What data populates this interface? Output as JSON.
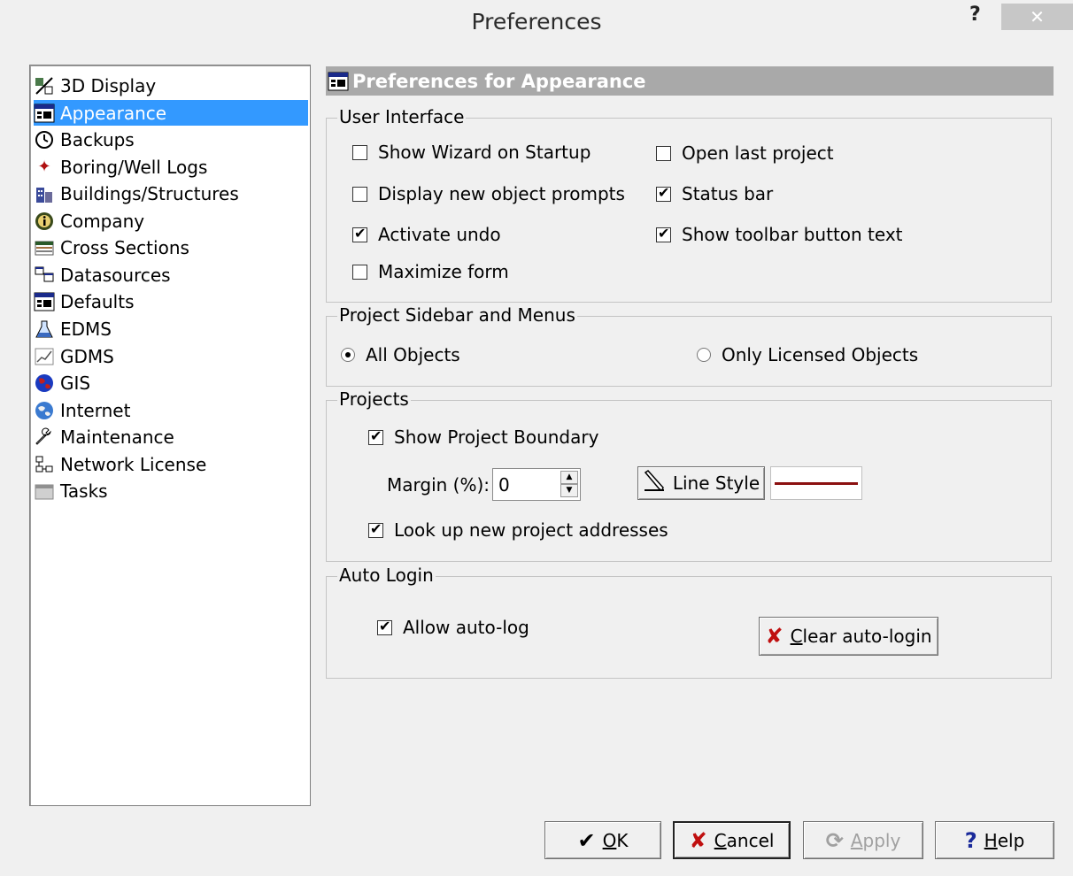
{
  "window": {
    "title": "Preferences",
    "help": "?",
    "close": "✕"
  },
  "tree": {
    "items": [
      {
        "label": "3D Display",
        "icon": "3d-display-icon",
        "selected": false
      },
      {
        "label": "Appearance",
        "icon": "appearance-icon",
        "selected": true
      },
      {
        "label": "Backups",
        "icon": "clock-icon",
        "selected": false
      },
      {
        "label": "Boring/Well Logs",
        "icon": "boring-icon",
        "selected": false
      },
      {
        "label": "Buildings/Structures",
        "icon": "buildings-icon",
        "selected": false
      },
      {
        "label": "Company",
        "icon": "info-icon",
        "selected": false
      },
      {
        "label": "Cross Sections",
        "icon": "cross-section-icon",
        "selected": false
      },
      {
        "label": "Datasources",
        "icon": "datasource-icon",
        "selected": false
      },
      {
        "label": "Defaults",
        "icon": "defaults-icon",
        "selected": false
      },
      {
        "label": "EDMS",
        "icon": "flask-icon",
        "selected": false
      },
      {
        "label": "GDMS",
        "icon": "chart-icon",
        "selected": false
      },
      {
        "label": "GIS",
        "icon": "globe-icon",
        "selected": false
      },
      {
        "label": "Internet",
        "icon": "internet-icon",
        "selected": false
      },
      {
        "label": "Maintenance",
        "icon": "wrench-icon",
        "selected": false
      },
      {
        "label": "Network License",
        "icon": "network-icon",
        "selected": false
      },
      {
        "label": "Tasks",
        "icon": "tasks-icon",
        "selected": false
      }
    ]
  },
  "header": {
    "title": "Preferences for Appearance"
  },
  "user_interface": {
    "title": "User Interface",
    "show_wizard": {
      "label": "Show Wizard on Startup",
      "checked": false
    },
    "open_last": {
      "label": "Open last project",
      "checked": false
    },
    "display_prompts": {
      "label": "Display new object prompts",
      "checked": false
    },
    "status_bar": {
      "label": "Status bar",
      "checked": true
    },
    "activate_undo": {
      "label": "Activate undo",
      "checked": true
    },
    "toolbar_text": {
      "label": "Show toolbar button text",
      "checked": true
    },
    "maximize_form": {
      "label": "Maximize form",
      "checked": false
    }
  },
  "sidebar_menus": {
    "title": "Project Sidebar and Menus",
    "all_objects": {
      "label": "All Objects",
      "checked": true
    },
    "licensed_objects": {
      "label": "Only Licensed Objects",
      "checked": false
    }
  },
  "projects": {
    "title": "Projects",
    "show_boundary": {
      "label": "Show Project Boundary",
      "checked": true
    },
    "margin_label": "Margin (%):",
    "margin_value": "0",
    "line_style_label": "Line Style",
    "line_color": "#8b1010",
    "lookup_addresses": {
      "label": "Look up new project addresses",
      "checked": true
    }
  },
  "auto_login": {
    "title": "Auto Login",
    "allow": {
      "label": "Allow auto-log",
      "checked": true
    },
    "clear_label_first": "C",
    "clear_label_rest": "lear auto-login"
  },
  "footer": {
    "ok_first": "O",
    "ok_rest": "K",
    "cancel_first": "C",
    "cancel_rest": "ancel",
    "apply_first": "A",
    "apply_rest": "pply",
    "help_first": "H",
    "help_rest": "elp"
  }
}
